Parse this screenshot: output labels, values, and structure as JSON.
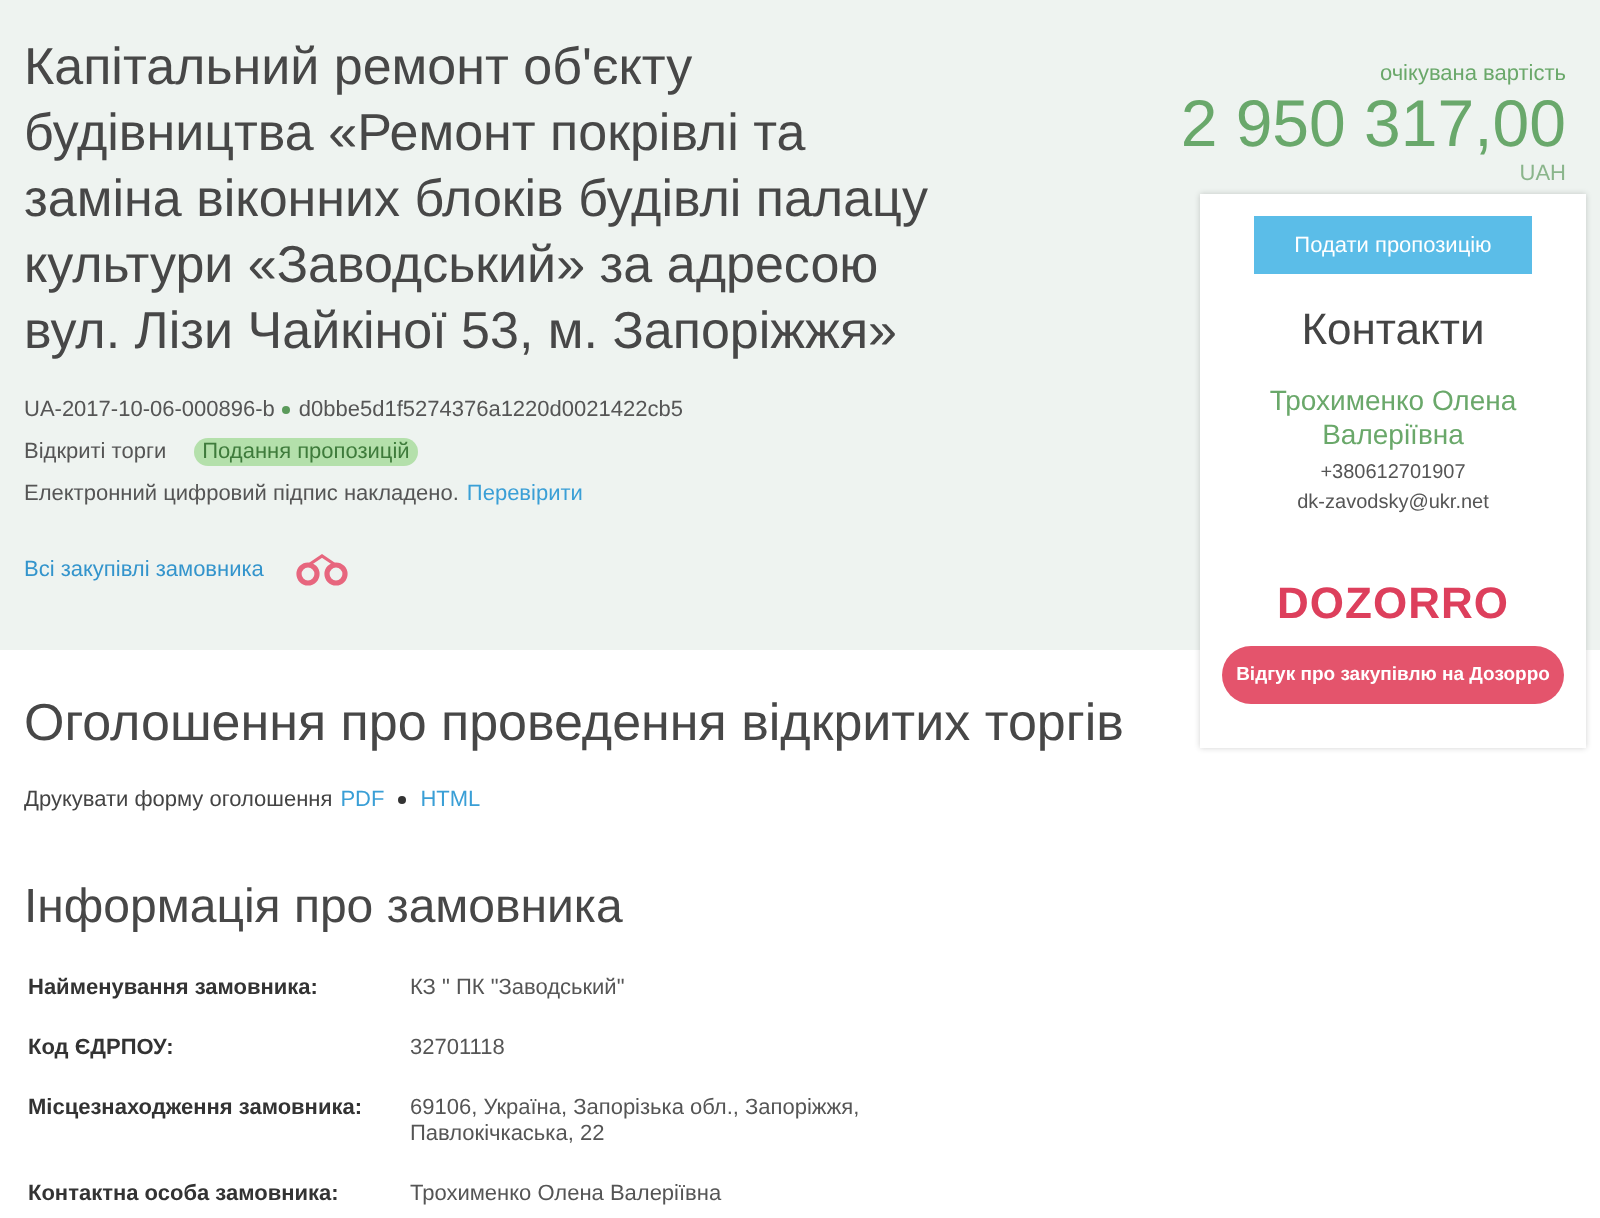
{
  "tender": {
    "title": "Капітальний ремонт об'єкту будівництва «Ремонт покрівлі та заміна віконних блоків будівлі палацу культури «Заводський» за адресою вул. Лізи Чайкіної 53, м. Запоріжжя»",
    "id": "UA-2017-10-06-000896-b",
    "hash": "d0bbe5d1f5274376a1220d0021422cb5",
    "procedure": "Відкриті торги",
    "status": "Подання пропозицій",
    "signature_text": "Електронний цифровий підпис накладено.",
    "signature_link": "Перевірити",
    "customer_link": "Всі закупівлі замовника"
  },
  "price": {
    "label": "очікувана вартість",
    "amount": "2 950 317,00",
    "currency": "UAH"
  },
  "contact_card": {
    "submit_button": "Подати пропозицію",
    "title": "Контакти",
    "name": "Трохименко Олена Валеріївна",
    "phone": "+380612701907",
    "email": "dk-zavodsky@ukr.net",
    "logo": "DOZORRO",
    "feedback_button": "Відгук про закупівлю на Дозорро"
  },
  "announcement": {
    "heading": "Оголошення про проведення відкритих торгів",
    "print_label": "Друкувати форму оголошення",
    "print_links": [
      "PDF",
      "HTML"
    ]
  },
  "customer_info": {
    "heading": "Інформація про замовника",
    "rows": [
      {
        "label": "Найменування замовника:",
        "value": "КЗ \" ПК \"Заводський\""
      },
      {
        "label": "Код ЄДРПОУ:",
        "value": "32701118"
      },
      {
        "label": "Місцезнаходження замовника:",
        "value": "69106, Україна, Запорізька обл., Запоріжжя, Павлокічкаська, 22"
      },
      {
        "label": "Контактна особа замовника:",
        "value": "Трохименко Олена Валеріївна"
      }
    ]
  }
}
